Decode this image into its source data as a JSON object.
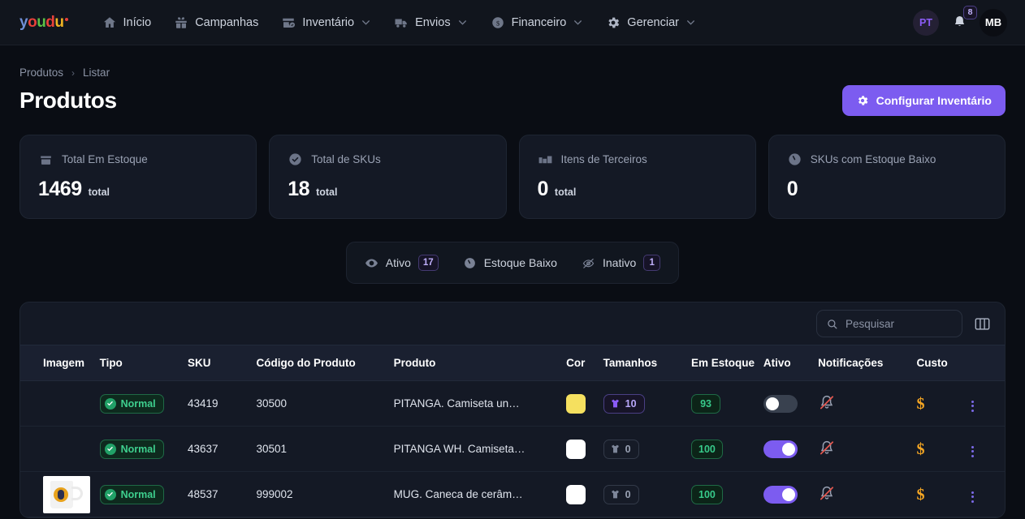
{
  "brand": {
    "name": "youdu",
    "letters": [
      {
        "ch": "y",
        "color": "#6f8fd6"
      },
      {
        "ch": "o",
        "color": "#e8413a"
      },
      {
        "ch": "u",
        "color": "#5bbf45"
      },
      {
        "ch": "d",
        "color": "#e8413a"
      },
      {
        "ch": "u",
        "color": "#f0b323"
      }
    ]
  },
  "nav": {
    "items": [
      {
        "label": "Início",
        "icon": "home-icon",
        "caret": false
      },
      {
        "label": "Campanhas",
        "icon": "gift-icon",
        "caret": false
      },
      {
        "label": "Inventário",
        "icon": "box-check-icon",
        "caret": true
      },
      {
        "label": "Envios",
        "icon": "truck-icon",
        "caret": true
      },
      {
        "label": "Financeiro",
        "icon": "dollar-circle-icon",
        "caret": true
      },
      {
        "label": "Gerenciar",
        "icon": "gear-icon",
        "caret": true
      }
    ],
    "user_initials": "PT",
    "notifications_count": "8",
    "account_initials": "MB"
  },
  "breadcrumb": {
    "parent": "Produtos",
    "separator": "›",
    "current": "Listar"
  },
  "header": {
    "title": "Produtos",
    "primary_button": "Configurar Inventário"
  },
  "stats": [
    {
      "label": "Total Em Estoque",
      "value": "1469",
      "unit": "total",
      "icon": "box-icon"
    },
    {
      "label": "Total de SKUs",
      "value": "18",
      "unit": "total",
      "icon": "check-circle-icon"
    },
    {
      "label": "Itens de Terceiros",
      "value": "0",
      "unit": "total",
      "icon": "boxes-icon"
    },
    {
      "label": "SKUs com Estoque Baixo",
      "value": "0",
      "unit": "",
      "icon": "gauge-low-icon"
    }
  ],
  "filter_tabs": [
    {
      "label": "Ativo",
      "badge": "17",
      "icon": "eye-icon"
    },
    {
      "label": "Estoque Baixo",
      "badge": "",
      "icon": "gauge-low-icon"
    },
    {
      "label": "Inativo",
      "badge": "1",
      "icon": "eye-off-icon"
    }
  ],
  "search": {
    "placeholder": "Pesquisar",
    "value": "",
    "columns_icon": "columns-icon"
  },
  "table": {
    "columns": [
      "Imagem",
      "Tipo",
      "SKU",
      "Código do Produto",
      "Produto",
      "Cor",
      "Tamanhos",
      "Em Estoque",
      "Ativo",
      "Notificações",
      "Custo"
    ],
    "rows": [
      {
        "image": "",
        "tipo": "Normal",
        "sku": "43419",
        "codigo": "30500",
        "produto": "PITANGA. Camiseta un…",
        "cor": "#f5e05f",
        "tamanhos": "10",
        "tamanhos_active": true,
        "em_estoque": "93",
        "ativo": false,
        "notificacao": "bell-muted-icon",
        "custo": "$"
      },
      {
        "image": "",
        "tipo": "Normal",
        "sku": "43637",
        "codigo": "30501",
        "produto": "PITANGA WH. Camiseta…",
        "cor": "#ffffff",
        "tamanhos": "0",
        "tamanhos_active": false,
        "em_estoque": "100",
        "ativo": true,
        "notificacao": "bell-muted-icon",
        "custo": "$"
      },
      {
        "image": "mug-thumbnail",
        "tipo": "Normal",
        "sku": "48537",
        "codigo": "999002",
        "produto": "MUG. Caneca de cerâm…",
        "cor": "#ffffff",
        "tamanhos": "0",
        "tamanhos_active": false,
        "em_estoque": "100",
        "ativo": true,
        "notificacao": "bell-muted-icon",
        "custo": "$"
      }
    ]
  },
  "colors": {
    "accent": "#7c5cf0",
    "page_bg": "#0a0d14",
    "card_bg": "#141925",
    "success": "#3ecf8e",
    "warning": "#f5a623",
    "danger": "#e8413a"
  }
}
